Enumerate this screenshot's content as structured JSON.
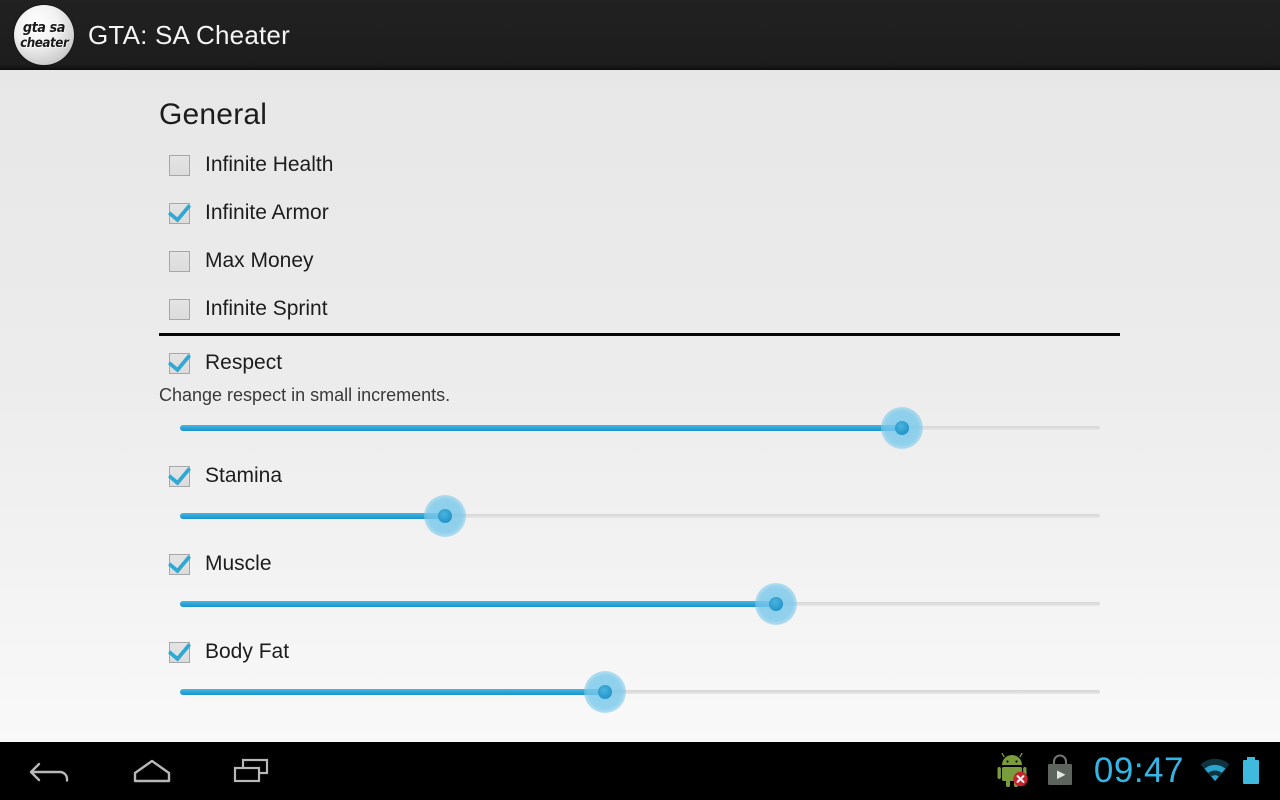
{
  "header": {
    "title": "GTA: SA Cheater",
    "app_icon": {
      "name": "gta-sa-cheater-icon",
      "line1": "gta sa",
      "line2": "cheater"
    }
  },
  "content": {
    "section_title": "General",
    "checkboxes": [
      {
        "label": "Infinite Health",
        "checked": false,
        "name": "checkbox-infinite-health"
      },
      {
        "label": "Infinite Armor",
        "checked": true,
        "name": "checkbox-infinite-armor"
      },
      {
        "label": "Max Money",
        "checked": false,
        "name": "checkbox-max-money"
      },
      {
        "label": "Infinite Sprint",
        "checked": false,
        "name": "checkbox-infinite-sprint"
      }
    ],
    "stat_sliders": [
      {
        "label": "Respect",
        "checked": true,
        "summary": "Change respect in small increments.",
        "value_percent": 78.5
      },
      {
        "label": "Stamina",
        "checked": true,
        "summary": "",
        "value_percent": 28.8
      },
      {
        "label": "Muscle",
        "checked": true,
        "summary": "",
        "value_percent": 64.8
      },
      {
        "label": "Body Fat",
        "checked": true,
        "summary": "",
        "value_percent": 46.2
      }
    ]
  },
  "navbar": {
    "back": "back-icon",
    "home": "home-icon",
    "recents": "recent-apps-icon"
  },
  "statusbar": {
    "android_warning": "android-warning-icon",
    "play_store": "play-store-icon",
    "clock": "09:47",
    "wifi": "wifi-icon",
    "battery": "battery-full-icon"
  },
  "colors": {
    "accent": "#2aa3d6",
    "clock": "#33b5e5",
    "action_bar": "#1f1f1f",
    "content_bg": "#eaeaea"
  }
}
